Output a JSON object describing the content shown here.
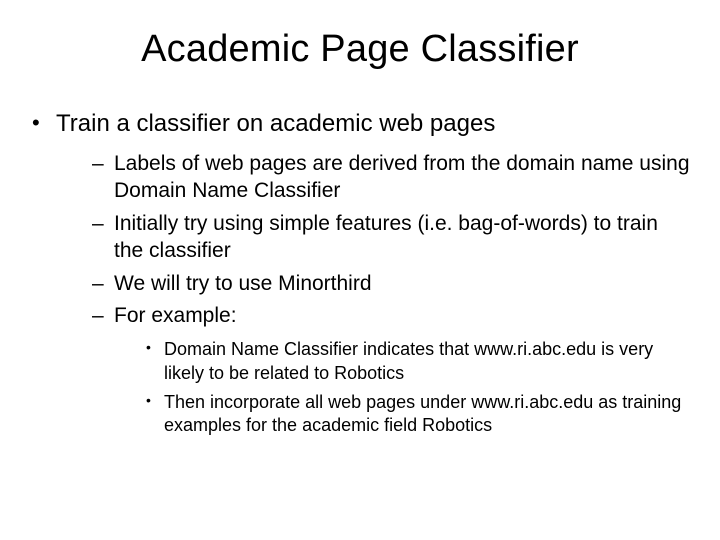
{
  "title": "Academic Page Classifier",
  "bullets": [
    {
      "text": "Train a classifier on academic web pages",
      "sub": [
        {
          "text": "Labels of web pages are derived from the domain name using Domain Name Classifier"
        },
        {
          "text": "Initially try using simple features (i.e. bag-of-words) to train the classifier"
        },
        {
          "text": "We will try to use Minorthird"
        },
        {
          "text": "For example:",
          "sub": [
            {
              "text": "Domain Name Classifier indicates that www.ri.abc.edu is very likely to be related to Robotics"
            },
            {
              "text": "Then incorporate all web pages under www.ri.abc.edu as training examples for the academic field Robotics"
            }
          ]
        }
      ]
    }
  ]
}
